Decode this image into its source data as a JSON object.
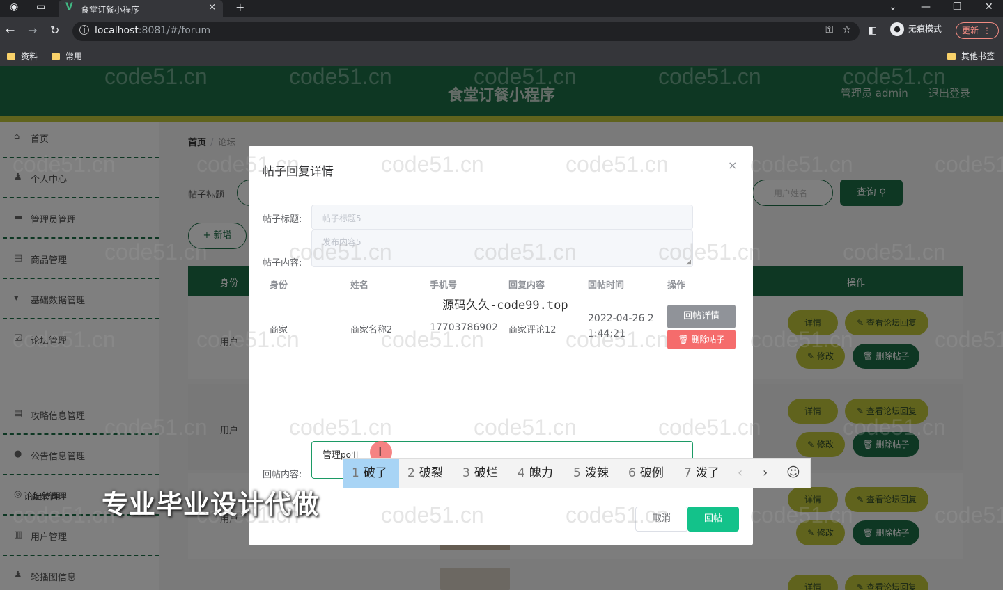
{
  "browser": {
    "tab_title": "食堂订餐小程序",
    "tab_close": "×",
    "new_tab": "+",
    "url_host": "localhost",
    "url_rest": ":8081/#/forum",
    "incognito_label": "无痕模式",
    "update_label": "更新",
    "bookmarks": [
      "资料",
      "常用"
    ],
    "other_bookmarks": "其他书签"
  },
  "header": {
    "title": "食堂订餐小程序",
    "admin": "管理员 admin",
    "logout": "退出登录"
  },
  "sidebar": {
    "items": [
      {
        "label": "首页",
        "icon": "home-icon"
      },
      {
        "label": "个人中心",
        "icon": "user-icon"
      },
      {
        "label": "管理员管理",
        "icon": "admin-icon"
      },
      {
        "label": "商品管理",
        "icon": "goods-icon"
      },
      {
        "label": "基础数据管理",
        "icon": "data-icon"
      },
      {
        "label": "论坛管理",
        "icon": "forum-icon"
      },
      {
        "label": "攻略信息管理",
        "icon": "guide-icon"
      },
      {
        "label": "公告信息管理",
        "icon": "notice-icon"
      },
      {
        "label": "商家管理",
        "icon": "merchant-icon"
      },
      {
        "label": "用户管理",
        "icon": "users-icon"
      },
      {
        "label": "轮播图信息",
        "icon": "carousel-icon"
      }
    ],
    "sub_item": "论坛管理"
  },
  "breadcrumb": {
    "home": "首页",
    "sep": "/",
    "current": "论坛"
  },
  "search": {
    "label": "帖子标题",
    "right_placeholder": "用户姓名",
    "query": "查询 ⚲",
    "add": "+ 新增"
  },
  "table": {
    "col_identity": "身份",
    "col_ops": "操作"
  },
  "rows": [
    {
      "user": "用户",
      "detail": "详情",
      "view": "✎ 查看论坛回复",
      "edit": "✎ 修改",
      "delete": "🗑 删除帖子"
    },
    {
      "user": "用户",
      "detail": "详情",
      "view": "✎ 查看论坛回复",
      "edit": "✎ 修改",
      "delete": "🗑 删除帖子"
    },
    {
      "user": "用户",
      "detail": "详情",
      "view": "✎ 查看论坛回复",
      "edit": "✎ 修改",
      "delete": "🗑 删除帖子"
    },
    {
      "user": "",
      "detail": "详情",
      "view": "✎ 查看论坛回复",
      "edit": "",
      "delete": ""
    }
  ],
  "dialog": {
    "title": "帖子回复详情",
    "close": "×",
    "post_title_label": "帖子标题:",
    "post_title_placeholder": "帖子标题5",
    "post_content_label": "帖子内容:",
    "post_content_placeholder": "发布内容5",
    "columns": [
      "身份",
      "姓名",
      "手机号",
      "回复内容",
      "回帖时间",
      "操作"
    ],
    "row": {
      "identity": "商家",
      "name": "商家名称2",
      "phone": "17703786902",
      "content": "商家评论12",
      "time_line1": "2022-04-26 2",
      "time_line2": "1:44:21",
      "detail_btn": "回帖详情",
      "delete_btn": "🗑 删除帖子"
    },
    "reply_label": "回帖内容:",
    "reply_text": "管理",
    "reply_pinyin": "po'l|",
    "cancel": "取消",
    "submit": "回帖"
  },
  "ime": {
    "candidates": [
      {
        "num": "1",
        "text": "破了"
      },
      {
        "num": "2",
        "text": "破裂"
      },
      {
        "num": "3",
        "text": "破烂"
      },
      {
        "num": "4",
        "text": "魄力"
      },
      {
        "num": "5",
        "text": "泼辣"
      },
      {
        "num": "6",
        "text": "破例"
      },
      {
        "num": "7",
        "text": "泼了"
      }
    ],
    "prev": "‹",
    "next": "›",
    "emoji": "☺"
  },
  "overlay_text": {
    "source_line": "源码久久-code99.top",
    "promo": "专业毕业设计代做",
    "watermark": "code51.cn"
  }
}
